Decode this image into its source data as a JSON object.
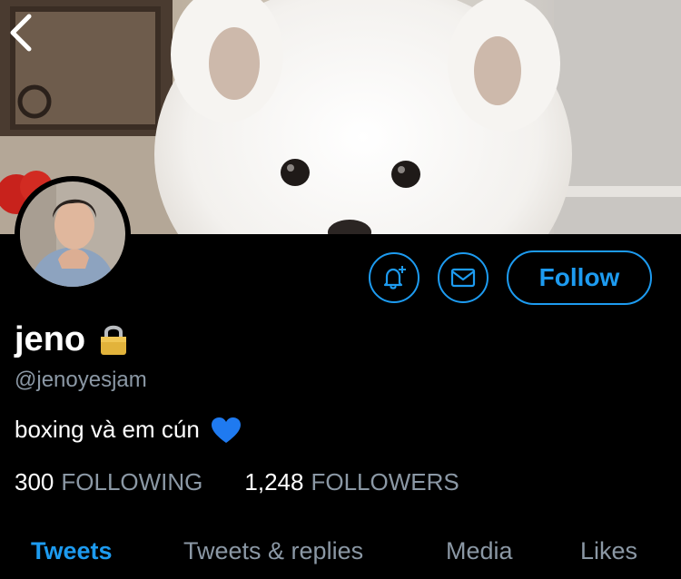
{
  "profile": {
    "name": "jeno",
    "handle": "@jenoyesjam",
    "bio": "boxing và em cún",
    "lock_emoji": "🔒",
    "bio_emoji": "blue-heart-icon"
  },
  "actions": {
    "notify_icon": "bell-plus-icon",
    "message_icon": "envelope-icon",
    "follow_label": "Follow"
  },
  "stats": {
    "following_count": "300",
    "following_label": "FOLLOWING",
    "followers_count": "1,248",
    "followers_label": "FOLLOWERS"
  },
  "tabs": [
    {
      "label": "Tweets",
      "active": true
    },
    {
      "label": "Tweets & replies",
      "active": false
    },
    {
      "label": "Media",
      "active": false
    },
    {
      "label": "Likes",
      "active": false
    }
  ],
  "colors": {
    "accent": "#1d9bf0",
    "secondary_text": "#8b98a5",
    "background": "#000000"
  }
}
